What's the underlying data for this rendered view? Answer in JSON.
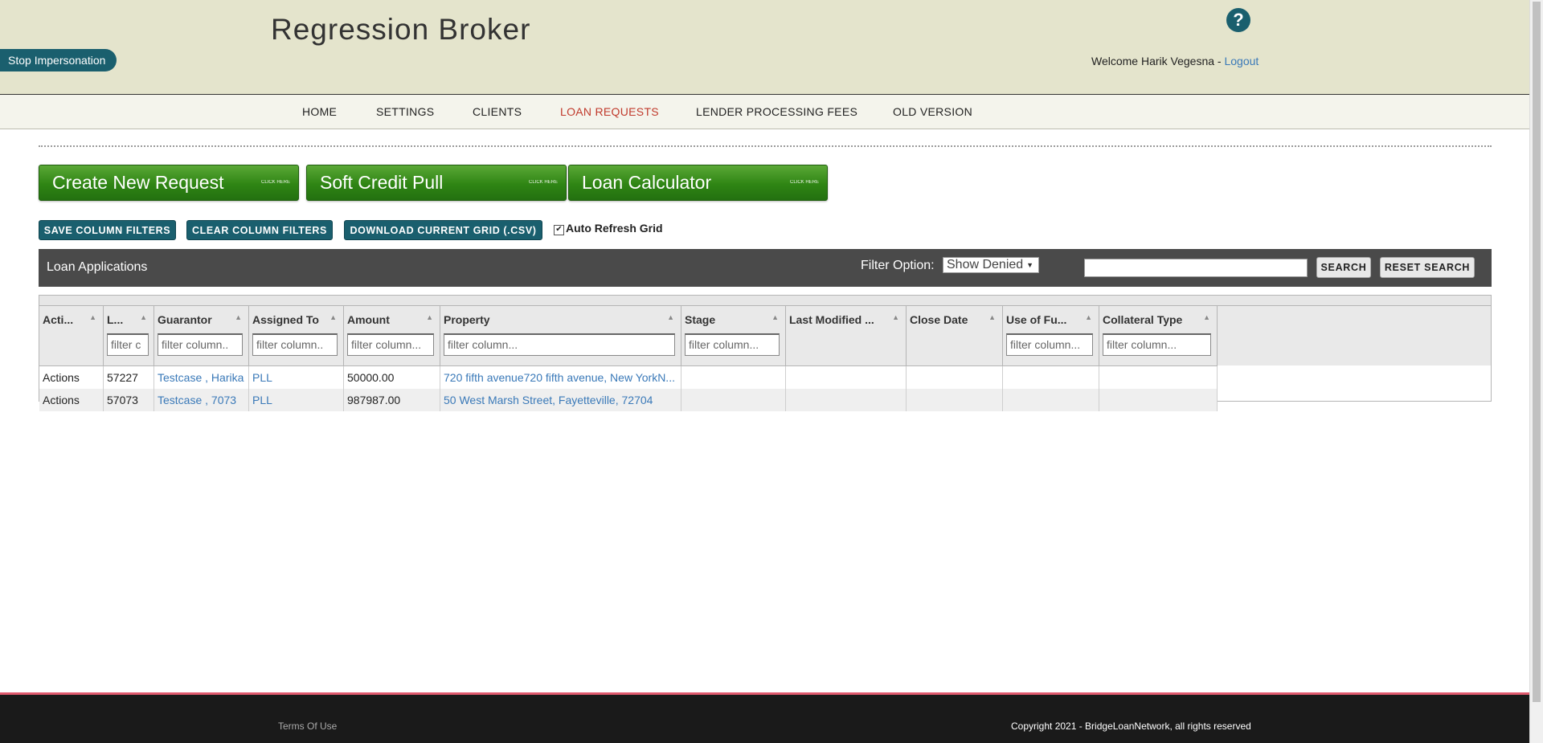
{
  "header": {
    "brand": "Regression Broker",
    "stop_impersonation": "Stop Impersonation",
    "help": "?",
    "welcome_text": "Welcome Harik Vegesna - ",
    "logout": "Logout"
  },
  "nav": {
    "items": [
      {
        "label": "HOME"
      },
      {
        "label": "SETTINGS"
      },
      {
        "label": "CLIENTS"
      },
      {
        "label": "LOAN REQUESTS",
        "active": true
      },
      {
        "label": "LENDER PROCESSING FEES"
      },
      {
        "label": "OLD VERSION"
      }
    ]
  },
  "actions": {
    "create_request": "Create New Request",
    "soft_credit": "Soft Credit Pull",
    "loan_calculator": "Loan Calculator",
    "click_here": "CLICK HERE",
    "save_filters": "SAVE COLUMN FILTERS",
    "clear_filters": "CLEAR COLUMN FILTERS",
    "download_csv": "DOWNLOAD CURRENT GRID (.CSV)",
    "auto_refresh": "Auto Refresh Grid",
    "auto_refresh_checked": true
  },
  "grid": {
    "title": "Loan Applications",
    "filter_option_label": "Filter Option:",
    "filter_option_value": "Show Denied",
    "search_value": "",
    "search_button": "SEARCH",
    "reset_button": "RESET SEARCH",
    "columns": [
      {
        "label": "Acti...",
        "filter": ""
      },
      {
        "label": "L...",
        "filter": "filter c"
      },
      {
        "label": "Guarantor",
        "filter": "filter column.."
      },
      {
        "label": "Assigned To",
        "filter": "filter column.."
      },
      {
        "label": "Amount",
        "filter": "filter column..."
      },
      {
        "label": "Property",
        "filter": "filter column..."
      },
      {
        "label": "Stage",
        "filter": "filter column..."
      },
      {
        "label": "Last Modified ...",
        "filter": ""
      },
      {
        "label": "Close Date",
        "filter": ""
      },
      {
        "label": "Use of Fu...",
        "filter": "filter column..."
      },
      {
        "label": "Collateral Type",
        "filter": "filter column..."
      }
    ],
    "rows": [
      {
        "actions": "Actions",
        "loan_id": "57227",
        "guarantor": "Testcase , Harika",
        "assigned_to": "PLL",
        "amount": "50000.00",
        "property": "720 fifth avenue720 fifth avenue, New YorkN...",
        "stage": "",
        "last_modified": "",
        "close_date": "",
        "use_of_funds": "",
        "collateral_type": ""
      },
      {
        "actions": "Actions",
        "loan_id": "57073",
        "guarantor": "Testcase , 7073",
        "assigned_to": "PLL",
        "amount": "987987.00",
        "property": "50 West Marsh Street, Fayetteville, 72704",
        "stage": "",
        "last_modified": "",
        "close_date": "",
        "use_of_funds": "",
        "collateral_type": ""
      }
    ]
  },
  "footer": {
    "terms": "Terms Of Use",
    "copyright": "Copyright 2021 - BridgeLoanNetwork, all rights reserved"
  }
}
